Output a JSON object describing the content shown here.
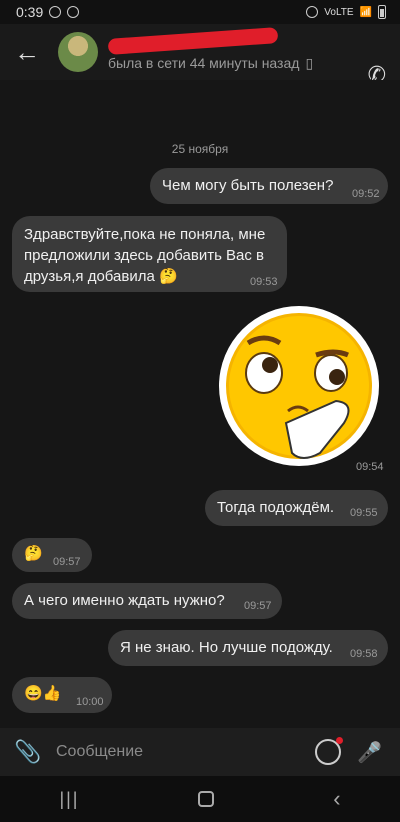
{
  "status_bar": {
    "time": "0:39",
    "carrier": "VoLTE",
    "icons": [
      "minus-circle-icon",
      "shield-icon",
      "alarm-icon",
      "wifi-icon",
      "signal-icon",
      "battery-icon"
    ]
  },
  "header": {
    "subtitle": "была в сети 44 минуты назад"
  },
  "chat": {
    "date": "25 ноября",
    "messages": [
      {
        "text": "Чем могу быть полезен?",
        "time": "09:52"
      },
      {
        "text": "Здравствуйте,пока не поняла, мне предложили здесь добавить Вас в друзья,я добавила 🤔",
        "time": "09:53"
      },
      {
        "text": "",
        "time": "09:54"
      },
      {
        "text": "Тогда подождём.",
        "time": "09:55"
      },
      {
        "text": "🤔",
        "time": "09:57"
      },
      {
        "text": "А чего именно ждать нужно?",
        "time": "09:57"
      },
      {
        "text": "Я не знаю. Но лучше подожду.",
        "time": "09:58"
      },
      {
        "text": "😄👍",
        "time": "10:00"
      }
    ]
  },
  "composer": {
    "placeholder": "Сообщение"
  },
  "nav": {
    "recent": "|||",
    "back": "‹"
  }
}
